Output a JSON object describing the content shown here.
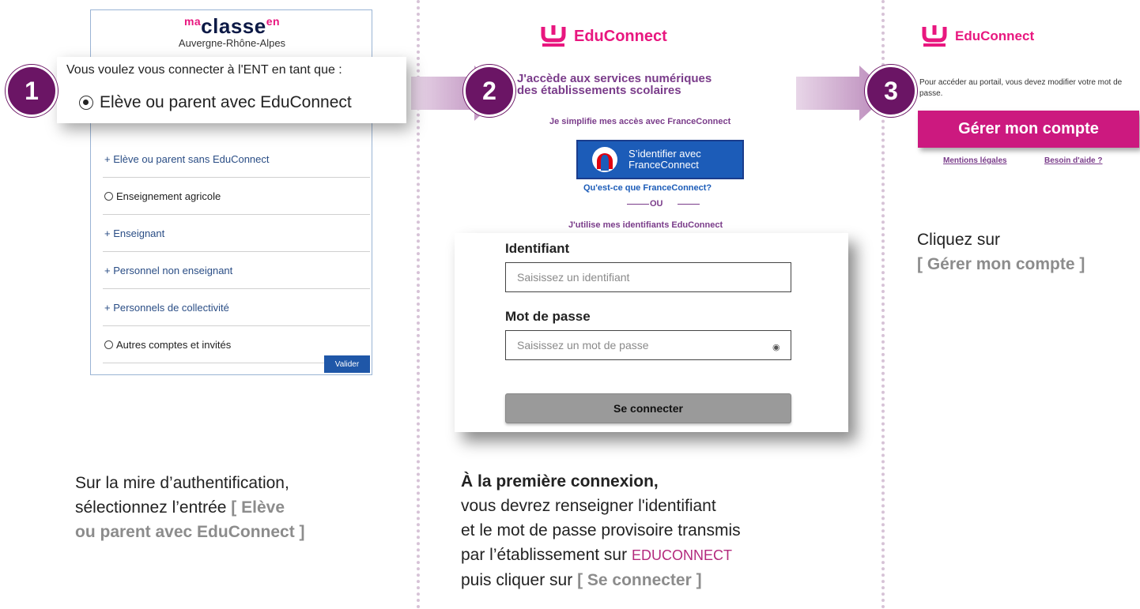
{
  "panel1": {
    "logo": {
      "prefix": "ma",
      "main": "classe",
      "suffix": "en",
      "region": "Auvergne-Rhône-Alpes"
    },
    "popup": {
      "title": "Vous voulez vous connecter à l'ENT en tant que :",
      "selected_option": "Elève ou parent avec EduConnect"
    },
    "options": [
      {
        "label": "+ Elève ou parent sans EduConnect"
      },
      {
        "label": "Enseignement agricole"
      },
      {
        "label": "+ Enseignant"
      },
      {
        "label": "+ Personnel non enseignant"
      },
      {
        "label": "+ Personnels de collectivité"
      },
      {
        "label": "Autres comptes et invités"
      }
    ],
    "validate_button": "Valider",
    "caption_line1": "Sur la mire d’authentification,",
    "caption_line2_prefix": "sélectionnez l’entrée ",
    "caption_hl_line2": "[ Elève",
    "caption_hl_line3": "ou parent avec EduConnect ]"
  },
  "panel2": {
    "logo_text": "EduConnect",
    "title_line1": "J'accède aux services numériques",
    "title_line2": "des établissements scolaires",
    "simplify_text": "Je simplifie mes accès avec FranceConnect",
    "fc_button_line1": "S’identifier avec",
    "fc_button_line2": "FranceConnect",
    "fc_what": "Qu'est-ce que FranceConnect?",
    "or_text": "OU",
    "use_ids_text": "J'utilise mes identifiants EduConnect",
    "identifier_label": "Identifiant",
    "identifier_placeholder": "Saisissez un identifiant",
    "password_label": "Mot de passe",
    "password_placeholder": "Saisissez un mot de passe",
    "connect_button": "Se connecter",
    "caption_bold": "À la première connexion,",
    "caption_line2": "vous devrez renseigner l'identifiant",
    "caption_line3": "et le mot de passe provisoire transmis",
    "caption_line4_prefix": "par l’établissement sur ",
    "caption_edu": "EDUCONNECT",
    "caption_line5_prefix": "puis cliquer sur ",
    "caption_hl": "[ Se connecter ]"
  },
  "panel3": {
    "logo_text": "EduConnect",
    "info_text": "Pour accéder au portail, vous devez modifier votre mot de passe.",
    "manage_button": "Gérer mon compte",
    "legal_link": "Mentions légales",
    "help_link": "Besoin d'aide ?",
    "caption_line1": "Cliquez sur",
    "caption_hl": "[ Gérer mon compte ]"
  },
  "steps": [
    "1",
    "2",
    "3"
  ],
  "colors": {
    "badge": "#6b1565",
    "brand_pink": "#e8177f",
    "manage_button": "#cc197f",
    "arrow": "#c9a3c9"
  }
}
